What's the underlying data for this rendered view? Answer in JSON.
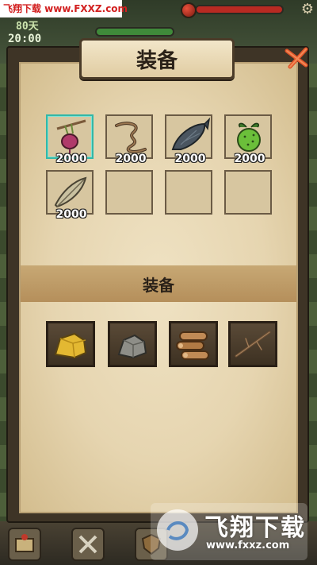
{
  "watermark_top": "飞翔下载 www.FXXZ.com",
  "hud": {
    "day": "80天",
    "time": "20:00"
  },
  "dialog": {
    "title": "装备",
    "section_title": "装备"
  },
  "inventory": [
    {
      "icon": "radish-icon",
      "qty": "2000",
      "selected": true
    },
    {
      "icon": "worm-icon",
      "qty": "2000",
      "selected": false
    },
    {
      "icon": "fish-icon",
      "qty": "2000",
      "selected": false
    },
    {
      "icon": "green-fruit-icon",
      "qty": "2000",
      "selected": false
    },
    {
      "icon": "feather-icon",
      "qty": "2000",
      "selected": false
    },
    {
      "icon": "empty-slot",
      "qty": "",
      "selected": false
    },
    {
      "icon": "empty-slot",
      "qty": "",
      "selected": false
    },
    {
      "icon": "empty-slot",
      "qty": "",
      "selected": false
    }
  ],
  "resources": [
    {
      "icon": "gold-ore-icon"
    },
    {
      "icon": "stone-icon"
    },
    {
      "icon": "wood-logs-icon"
    },
    {
      "icon": "twig-icon"
    }
  ],
  "watermark_bottom": {
    "title": "飞翔下载",
    "url": "www.fxxz.com"
  },
  "colors": {
    "selected_border": "#32b8a8",
    "parchment": "#e6d5b0",
    "band": "#b58f5b"
  }
}
